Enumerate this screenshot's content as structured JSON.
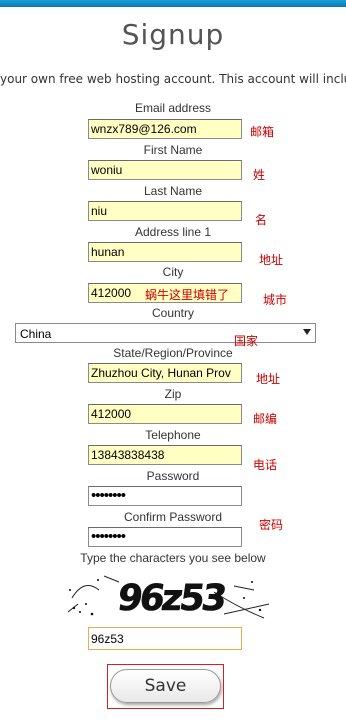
{
  "header": {
    "title": "Signup"
  },
  "intro_text": "your own free web hosting account. This account will include un",
  "form": {
    "email": {
      "label": "Email address",
      "value": "wnzx789@126.com",
      "note": "邮箱"
    },
    "first_name": {
      "label": "First Name",
      "value": "woniu",
      "note": "姓"
    },
    "last_name": {
      "label": "Last Name",
      "value": "niu",
      "note": "名"
    },
    "address1": {
      "label": "Address line 1",
      "value": "hunan",
      "note": "地址"
    },
    "city": {
      "label": "City",
      "value": "412000",
      "inline_note": "蜗牛这里填错了",
      "note": "城市"
    },
    "country": {
      "label": "Country",
      "value": "China",
      "note": "国家"
    },
    "state": {
      "label": "State/Region/Province",
      "value": "Zhuzhou City, Hunan Prov",
      "note": "地址"
    },
    "zip": {
      "label": "Zip",
      "value": "412000",
      "note": "邮编"
    },
    "telephone": {
      "label": "Telephone",
      "value": "13843838438",
      "note": "电话"
    },
    "password": {
      "label": "Password",
      "value": "••••••••"
    },
    "confirm_password": {
      "label": "Confirm Password",
      "value": "••••••••",
      "note": "密码"
    },
    "captcha": {
      "label": "Type the characters you see below",
      "image_text": "96z53",
      "value": "96z53"
    },
    "save_label": "Save"
  },
  "colors": {
    "note_red": "#cc0000",
    "field_yellow": "#ffffc4",
    "top_bar": "#0b78b3"
  }
}
